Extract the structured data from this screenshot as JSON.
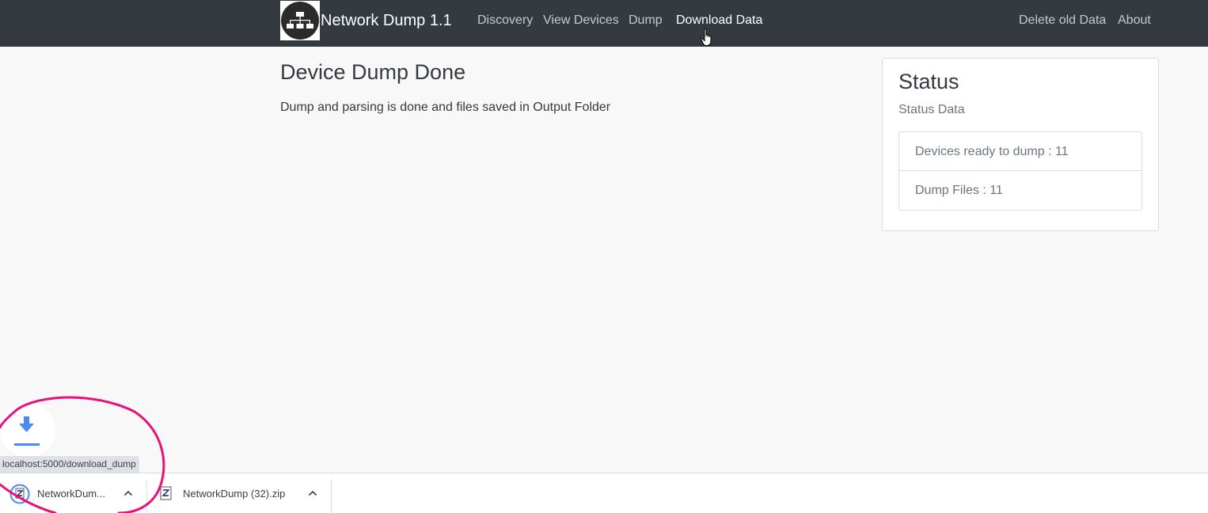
{
  "navbar": {
    "brand": "Network Dump 1.1",
    "links": [
      "Discovery",
      "View Devices",
      "Dump",
      "Download Data"
    ],
    "active_link": "Download Data",
    "right_links": [
      "Delete old Data",
      "About"
    ]
  },
  "main": {
    "title": "Device Dump Done",
    "text": "Dump and parsing is done and files saved in Output Folder"
  },
  "status_card": {
    "title": "Status",
    "subtitle": "Status Data",
    "items": [
      "Devices ready to dump : 11",
      "Dump Files : 11"
    ]
  },
  "browser": {
    "status_url": "localhost:5000/download_dump",
    "downloads": [
      "NetworkDum...",
      "NetworkDump (32).zip"
    ]
  },
  "colors": {
    "navbar": "#343a40",
    "annotation": "#e8107a",
    "download_blue": "#4a8af4"
  }
}
